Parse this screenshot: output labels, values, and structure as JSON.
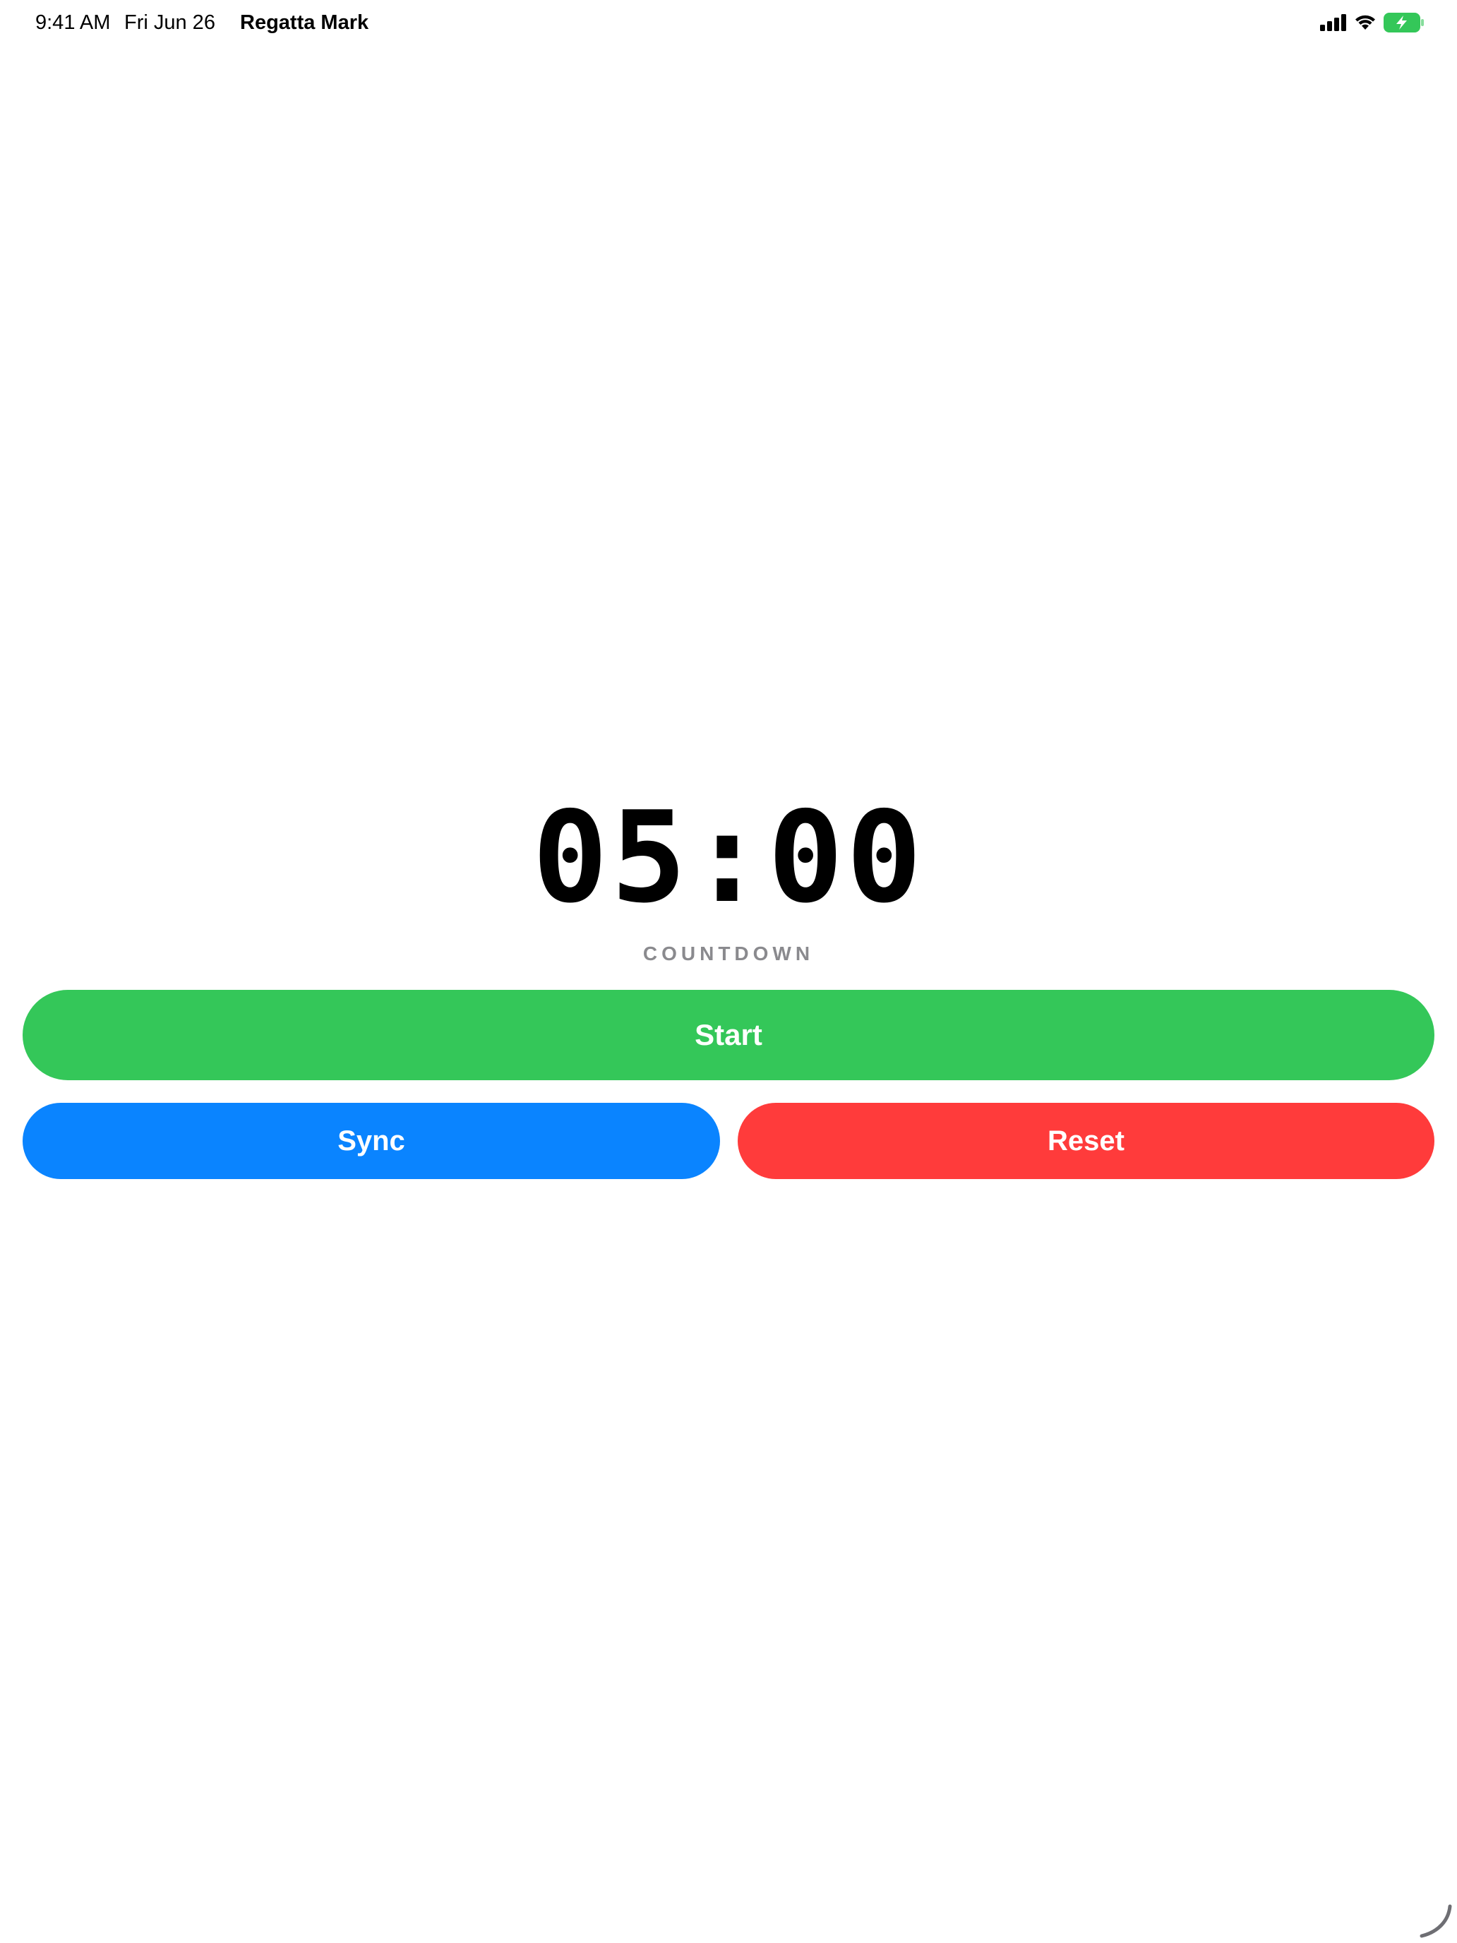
{
  "status_bar": {
    "time": "9:41 AM",
    "date": "Fri Jun 26",
    "app_name": "Regatta Mark",
    "icons": [
      "cellular-signal-icon",
      "wifi-icon",
      "battery-charging-icon"
    ],
    "battery_color": "#34c759"
  },
  "timer": {
    "value": "05:00",
    "caption": "COUNTDOWN"
  },
  "buttons": {
    "start_label": "Start",
    "sync_label": "Sync",
    "reset_label": "Reset"
  },
  "colors": {
    "start": "#34c759",
    "sync": "#0a84ff",
    "reset": "#ff3b3b",
    "caption": "#8a8a8e"
  }
}
